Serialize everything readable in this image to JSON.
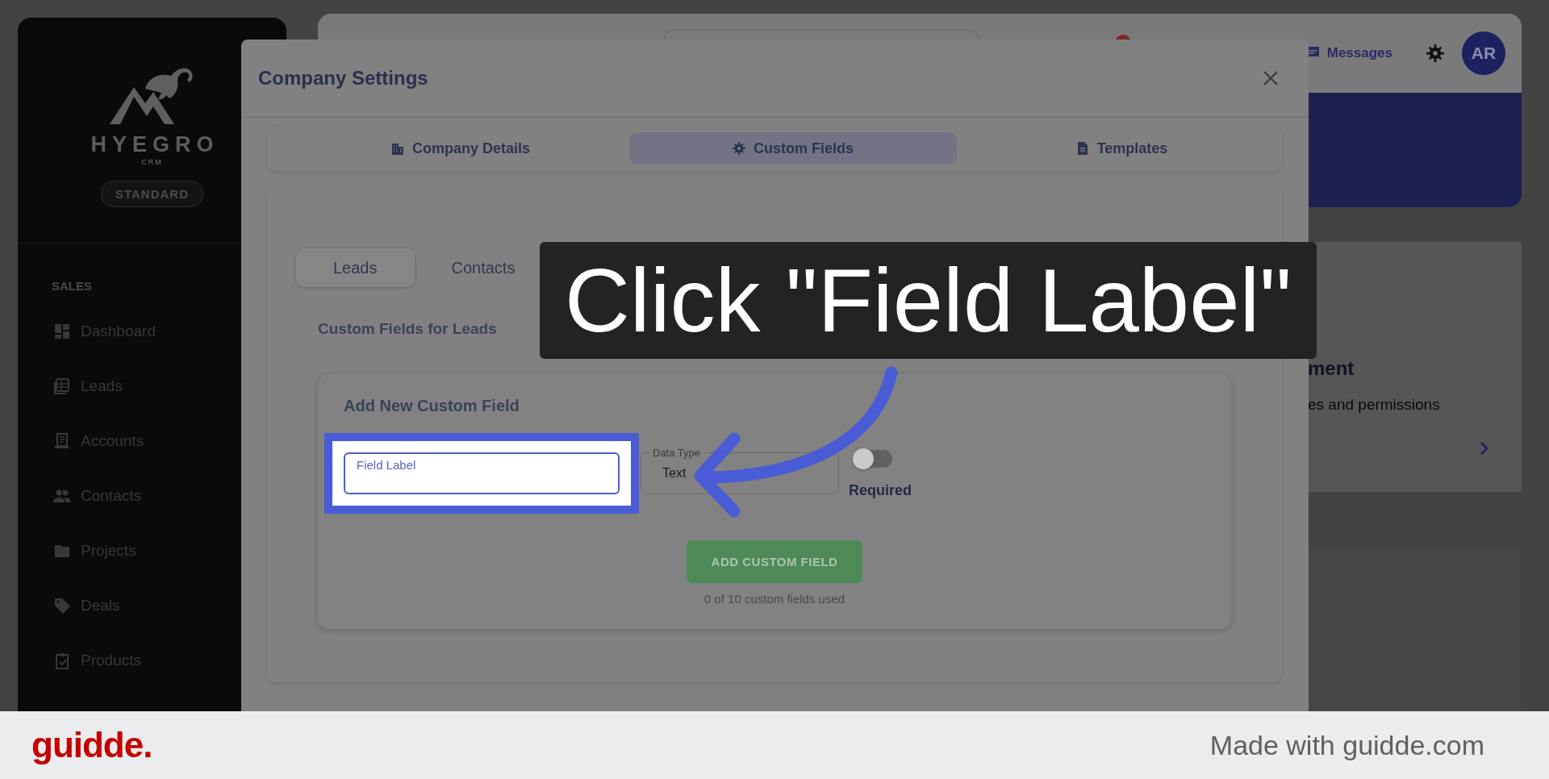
{
  "sidebar": {
    "logo": {
      "name": "HYEGRO",
      "tagline": "CRM"
    },
    "plan": "STANDARD",
    "section": "SALES",
    "items": [
      "Dashboard",
      "Leads",
      "Accounts",
      "Contacts",
      "Projects",
      "Deals",
      "Products"
    ]
  },
  "header": {
    "messages": "Messages",
    "avatar": "AR"
  },
  "background_card": {
    "title": "ment",
    "description": "es and permissions"
  },
  "dialog": {
    "title": "Company Settings",
    "tabs": [
      {
        "label": "Company Details",
        "selected": false
      },
      {
        "label": "Custom Fields",
        "selected": true
      },
      {
        "label": "Templates",
        "selected": false
      }
    ],
    "entity_tabs": [
      {
        "label": "Leads",
        "selected": true
      },
      {
        "label": "Contacts",
        "selected": false
      }
    ],
    "section_title": "Custom Fields for Leads",
    "form": {
      "title": "Add New Custom Field",
      "field_label": {
        "label": "Field Label"
      },
      "data_type": {
        "label": "Data Type",
        "value": "Text"
      },
      "required": {
        "label": "Required",
        "on": false
      },
      "button": "ADD CUSTOM FIELD",
      "usage": "0 of 10 custom fields used"
    }
  },
  "callout": {
    "text": "Click \"Field Label\""
  },
  "footer": {
    "logo": "guidde.",
    "credit": "Made with guidde.com"
  }
}
